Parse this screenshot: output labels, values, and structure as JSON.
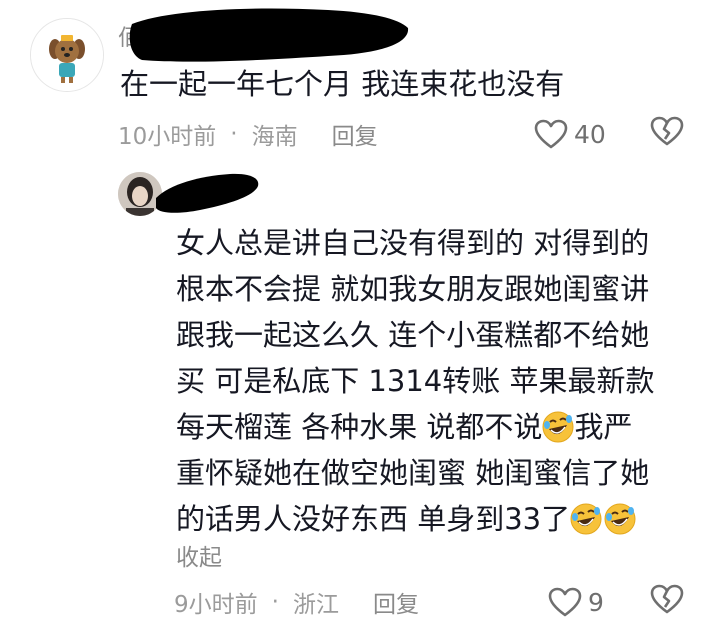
{
  "comment": {
    "author_visible": "佰",
    "text": "在一起一年七个月 我连束花也没有",
    "time": "10小时前",
    "location": "海南",
    "reply_label": "回复",
    "like_count": "40"
  },
  "reply": {
    "lines": [
      "女人总是讲自己没有得到的 对得到的",
      "根本不会提  就如我女朋友跟她闺蜜讲",
      "跟我一起这么久  连个小蛋糕都不给她",
      "买  可是私底下 1314转账 苹果最新款",
      "每天榴莲 各种水果 说都不说 ",
      "我严",
      "重怀疑她在做空她闺蜜  她闺蜜信了她",
      "的话男人没好东西 单身到33了"
    ],
    "collapse_label": "收起",
    "time": "9小时前",
    "location": "浙江",
    "reply_label": "回复",
    "like_count": "9"
  },
  "meta_separator": "·",
  "icons": {
    "like": "heart-outline-icon",
    "dislike": "broken-heart-icon",
    "emoji": "rolling-laughing-emoji-icon"
  },
  "colors": {
    "text": "#161823",
    "meta": "#9b9b9b",
    "redaction": "#000000",
    "emoji_yellow": "#f7c23a"
  }
}
